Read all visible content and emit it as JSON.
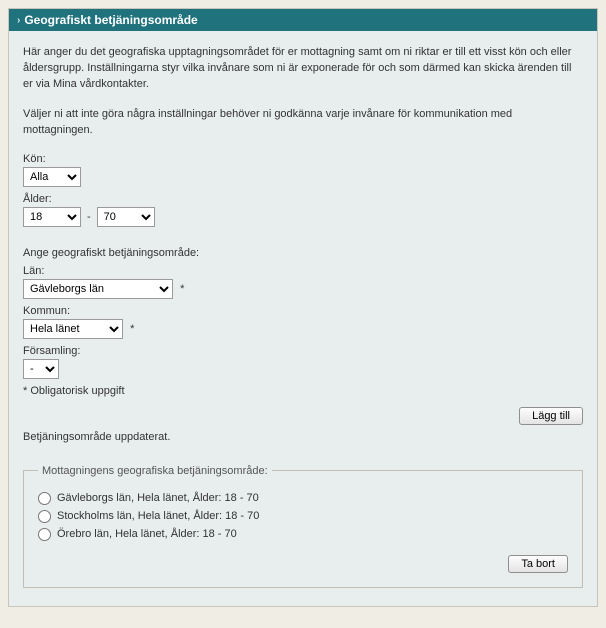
{
  "header": {
    "title": "Geografiskt betjäningsområde"
  },
  "intro": {
    "p1": "Här anger du det geografiska upptagningsområdet för er mottagning samt om ni riktar er till ett visst kön och eller åldersgrupp. Inställningarna styr vilka invånare som ni är exponerade för och som därmed kan skicka ärenden till er via Mina vårdkontakter.",
    "p2": "Väljer ni att inte göra några inställningar behöver ni godkänna varje invånare för kommunikation med mottagningen."
  },
  "fields": {
    "gender_label": "Kön:",
    "gender_value": "Alla",
    "age_label": "Ålder:",
    "age_from": "18",
    "age_to": "70",
    "age_sep": "-",
    "geo_heading": "Ange geografiskt betjäningsområde:",
    "county_label": "Län:",
    "county_value": "Gävleborgs län",
    "municipality_label": "Kommun:",
    "municipality_value": "Hela länet",
    "parish_label": "Församling:",
    "parish_value": "-",
    "required_note": "* Obligatorisk uppgift",
    "star": "*"
  },
  "buttons": {
    "add": "Lägg till",
    "remove": "Ta bort"
  },
  "status": "Betjäningsområde uppdaterat.",
  "areas": {
    "legend": "Mottagningens geografiska betjäningsområde:",
    "items": [
      "Gävleborgs län, Hela länet, Ålder: 18 - 70",
      "Stockholms län, Hela länet, Ålder: 18 - 70",
      "Örebro län, Hela länet, Ålder: 18 - 70"
    ]
  }
}
